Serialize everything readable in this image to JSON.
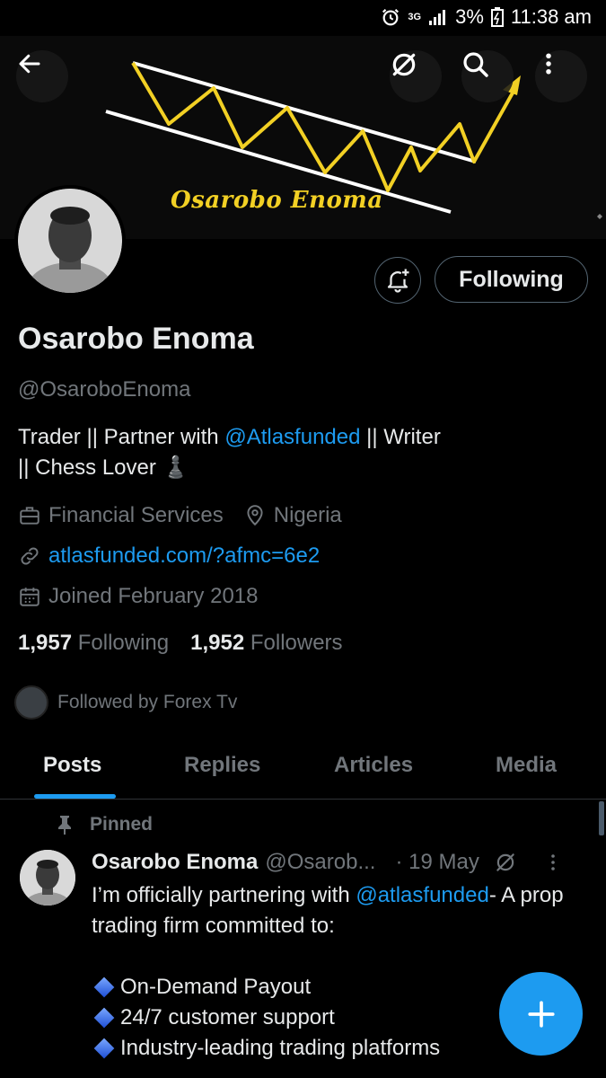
{
  "status_bar": {
    "network": "3G",
    "battery": "3%",
    "time": "11:38 am"
  },
  "banner": {
    "text": "Osarobo Enoma"
  },
  "profile": {
    "name": "Osarobo Enoma",
    "handle": "@OsaroboEnoma",
    "bio_prefix": "Trader || Partner with ",
    "bio_mention": "@Atlasfunded",
    "bio_suffix": " || Writer",
    "bio_line2": "|| Chess Lover ♟️",
    "category": "Financial Services",
    "location": "Nigeria",
    "website": "atlasfunded.com/?afmc=6e2",
    "joined": "Joined February 2018",
    "following_count": "1,957",
    "following_label": "Following",
    "followers_count": "1,952",
    "followers_label": "Followers",
    "followed_by": "Followed by Forex Tv"
  },
  "actions": {
    "following_button": "Following"
  },
  "tabs": [
    {
      "label": "Posts",
      "active": true
    },
    {
      "label": "Replies",
      "active": false
    },
    {
      "label": "Articles",
      "active": false
    },
    {
      "label": "Media",
      "active": false
    }
  ],
  "pinned_post": {
    "pinned_label": "Pinned",
    "author_name": "Osarobo Enoma",
    "author_handle": "@Osarob...",
    "date": "· 19 May",
    "text_prefix": "I’m officially partnering with ",
    "text_mention": "@atlasfunded",
    "text_suffix": "- A prop trading firm committed to:",
    "bullets": [
      "On-Demand Payout",
      "24/7 customer support",
      "Industry-leading trading platforms"
    ]
  },
  "colors": {
    "accent": "#1d9bf0",
    "banner_gold": "#f2d024",
    "muted": "#71767b"
  }
}
